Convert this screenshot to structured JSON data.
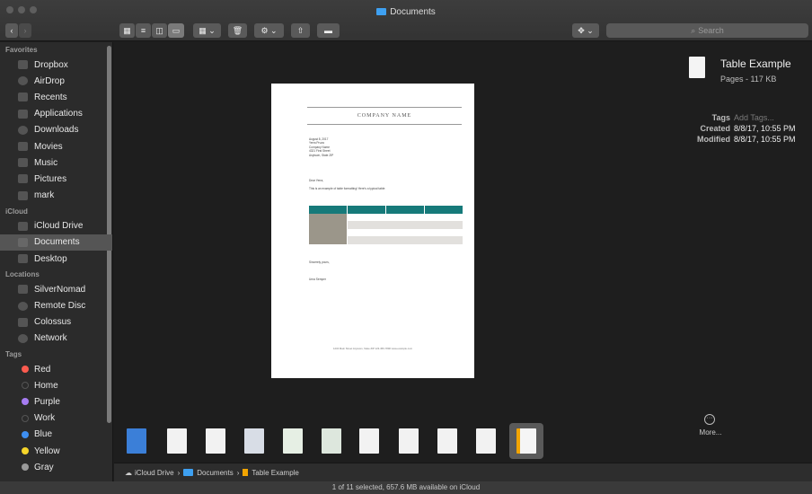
{
  "window": {
    "title": "Documents"
  },
  "toolbar": {
    "search_placeholder": "Search"
  },
  "sidebar": {
    "sections": [
      {
        "heading": "Favorites",
        "items": [
          "Dropbox",
          "AirDrop",
          "Recents",
          "Applications",
          "Downloads",
          "Movies",
          "Music",
          "Pictures",
          "mark"
        ]
      },
      {
        "heading": "iCloud",
        "items": [
          "iCloud Drive",
          "Documents",
          "Desktop"
        ]
      },
      {
        "heading": "Locations",
        "items": [
          "SilverNomad",
          "Remote Disc",
          "Colossus",
          "Network"
        ]
      },
      {
        "heading": "Tags",
        "items": [
          "Red",
          "Home",
          "Purple",
          "Work",
          "Blue",
          "Yellow",
          "Gray"
        ]
      }
    ],
    "selected": "Documents",
    "tag_colors": {
      "Red": "#fb5b4f",
      "Purple": "#a67cf1",
      "Blue": "#3e8ff1",
      "Yellow": "#f6d52a",
      "Gray": "#9a9a9a"
    }
  },
  "document": {
    "company_name": "COMPANY NAME",
    "address_lines": [
      "August 8, 2017",
      "Yerra Pruza",
      "Company Name",
      "4321 First Street",
      "Anytown, State ZIP"
    ],
    "greeting": "Dear Yerra,",
    "body": "This is an example of table formatting! Here's a typical table:",
    "closing": "Sincerely yours,",
    "signature": "Urna Semper",
    "footer": "1234 Main Street  Anytown, State ZIP   123-456-7890   www.example.com",
    "accent_color": "#167a7a"
  },
  "info": {
    "name": "Table Example",
    "kind_size": "Pages - 117 KB",
    "tags_label": "Tags",
    "tags_placeholder": "Add Tags...",
    "created_label": "Created",
    "created_value": "8/8/17, 10:55 PM",
    "modified_label": "Modified",
    "modified_value": "8/8/17, 10:55 PM",
    "more_label": "More..."
  },
  "pathbar": {
    "segments": [
      "iCloud Drive",
      "Documents",
      "Table Example"
    ]
  },
  "status": {
    "text": "1 of 11 selected, 657.6 MB available on iCloud"
  }
}
